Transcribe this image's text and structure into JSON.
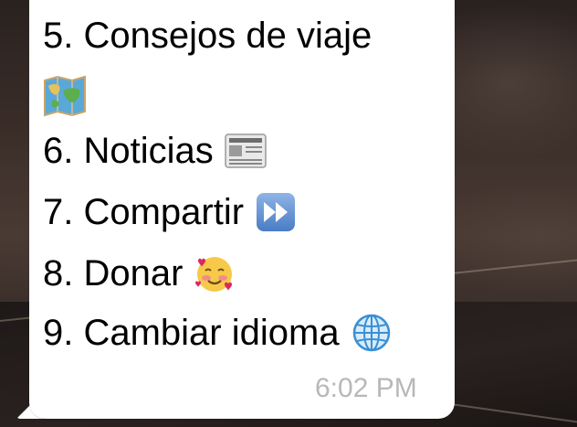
{
  "chat": {
    "menu_items": [
      {
        "label": "5. Consejos de viaje",
        "emoji_icon": "world-map-icon"
      },
      {
        "label": "6. Noticias",
        "emoji_icon": "newspaper-icon"
      },
      {
        "label": "7. Compartir",
        "emoji_icon": "fast-forward-icon"
      },
      {
        "label": "8. Donar",
        "emoji_icon": "smiling-face-with-hearts-icon"
      },
      {
        "label": "9. Cambiar idioma",
        "emoji_icon": "globe-meridians-icon"
      }
    ],
    "timestamp": "6:02 PM",
    "colors": {
      "bubble": "#ffffff",
      "text": "#000000",
      "timestamp": "#b8b8b8"
    }
  }
}
